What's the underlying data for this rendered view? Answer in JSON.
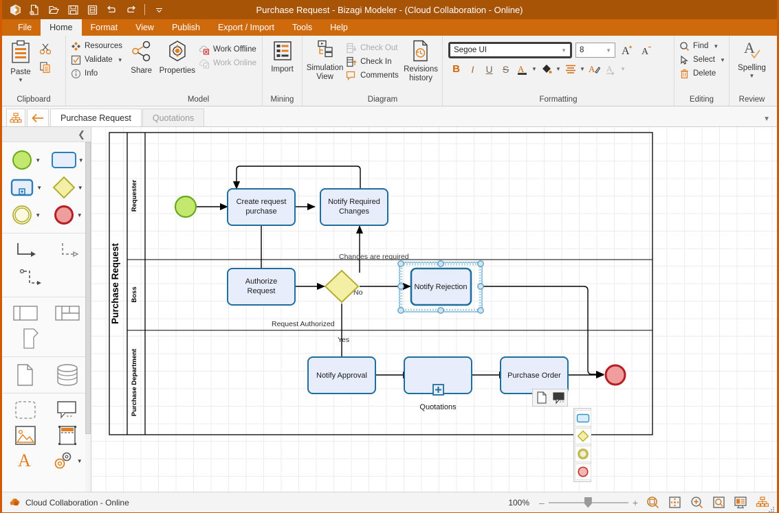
{
  "window": {
    "title": "Purchase Request - Bizagi Modeler - (Cloud Collaboration - Online)",
    "accent": "#cf6a0c",
    "titlebar_bg": "#a85406"
  },
  "quick_access": [
    {
      "name": "app-logo",
      "icon": "bizagi-logo-icon"
    },
    {
      "name": "new",
      "icon": "new-document-icon"
    },
    {
      "name": "open",
      "icon": "open-folder-icon"
    },
    {
      "name": "save",
      "icon": "save-disk-icon"
    },
    {
      "name": "save-as",
      "icon": "save-as-icon"
    },
    {
      "name": "undo",
      "icon": "undo-arrow-icon"
    },
    {
      "name": "redo",
      "icon": "redo-arrow-icon"
    },
    {
      "name": "customize",
      "icon": "chevron-down-icon"
    }
  ],
  "ribbon": {
    "tabs": [
      {
        "label": "File",
        "active": false
      },
      {
        "label": "Home",
        "active": true
      },
      {
        "label": "Format",
        "active": false
      },
      {
        "label": "View",
        "active": false
      },
      {
        "label": "Publish",
        "active": false
      },
      {
        "label": "Export / Import",
        "active": false
      },
      {
        "label": "Tools",
        "active": false
      },
      {
        "label": "Help",
        "active": false
      }
    ],
    "groups": {
      "clipboard": {
        "label": "Clipboard",
        "paste": "Paste",
        "cut_icon": "scissors-icon",
        "copy_icon": "copy-icon"
      },
      "model": {
        "label": "Model",
        "resources": "Resources",
        "validate": "Validate",
        "info": "Info",
        "share": "Share",
        "properties": "Properties",
        "work_offline": "Work Offline",
        "work_online": "Work Online"
      },
      "mining": {
        "label": "Mining",
        "import": "Import"
      },
      "diagram": {
        "label": "Diagram",
        "simulation_view": "Simulation\nView",
        "simulation_view_l1": "Simulation",
        "simulation_view_l2": "View",
        "check_out": "Check Out",
        "check_in": "Check In",
        "comments": "Comments",
        "revisions_l1": "Revisions",
        "revisions_l2": "history"
      },
      "formatting": {
        "label": "Formatting",
        "font_family": "Segoe UI",
        "font_size": "8",
        "grow_font": "A",
        "shrink_font": "A",
        "bold": "B",
        "italic": "I",
        "underline": "U",
        "strikethrough": "S",
        "font_color_icon": "font-color-icon",
        "fill_color_icon": "fill-color-icon",
        "align_icon": "align-icon",
        "format-painter_icon": "format-painter-icon",
        "clear_format_icon": "clear-formatting-icon"
      },
      "editing": {
        "label": "Editing",
        "find": "Find",
        "select": "Select",
        "delete": "Delete"
      },
      "review": {
        "label": "Review",
        "spelling": "Spelling"
      }
    }
  },
  "doc_tabs": {
    "diagram_list_icon": "diagram-tree-icon",
    "back_icon": "back-arrow-icon",
    "tabs": [
      {
        "label": "Purchase Request",
        "active": true
      },
      {
        "label": "Quotations",
        "active": false
      }
    ],
    "overflow_icon": "chevron-down-icon"
  },
  "palette": {
    "collapse_icon": "chevron-left-icon",
    "sections": [
      {
        "name": "events-activities",
        "rows": [
          [
            {
              "icon": "start-event-icon",
              "caret": true
            },
            {
              "icon": "task-icon",
              "caret": true
            }
          ],
          [
            {
              "icon": "subprocess-icon",
              "caret": true
            },
            {
              "icon": "gateway-icon",
              "caret": true
            }
          ],
          [
            {
              "icon": "intermediate-event-icon",
              "caret": true
            },
            {
              "icon": "end-event-icon",
              "caret": true
            }
          ]
        ]
      },
      {
        "name": "connectors",
        "rows": [
          [
            {
              "icon": "sequence-flow-icon",
              "caret": false
            },
            {
              "icon": "message-flow-icon",
              "caret": false
            }
          ],
          [
            {
              "icon": "association-icon",
              "caret": false
            }
          ]
        ]
      },
      {
        "name": "pools-lanes",
        "rows": [
          [
            {
              "icon": "pool-icon",
              "caret": false
            },
            {
              "icon": "lane-icon",
              "caret": false
            }
          ],
          [
            {
              "icon": "milestone-icon",
              "caret": false
            }
          ]
        ]
      },
      {
        "name": "artifacts-data",
        "rows": [
          [
            {
              "icon": "data-object-icon",
              "caret": false
            },
            {
              "icon": "data-store-icon",
              "caret": false
            }
          ]
        ]
      },
      {
        "name": "annotations",
        "rows": [
          [
            {
              "icon": "group-icon",
              "caret": false
            },
            {
              "icon": "annotation-icon",
              "caret": false
            }
          ],
          [
            {
              "icon": "image-icon",
              "caret": false
            },
            {
              "icon": "header-icon",
              "caret": false
            }
          ],
          [
            {
              "icon": "text-icon",
              "caret": false
            },
            {
              "icon": "custom-shapes-icon",
              "caret": true
            }
          ]
        ]
      }
    ]
  },
  "diagram": {
    "pool_label": "Purchase Request",
    "lanes": [
      {
        "label": "Requester"
      },
      {
        "label": "Boss"
      },
      {
        "label": "Purchase Department"
      }
    ],
    "shapes": {
      "start_event": {
        "name": "start-event",
        "fill": "#c3e86e",
        "stroke": "#6aa81a"
      },
      "create_request": {
        "label_l1": "Create request",
        "label_l2": "purchase"
      },
      "notify_required_changes": {
        "label_l1": "Notify Required",
        "label_l2": "Changes"
      },
      "authorize_request": {
        "label_l1": "Authorize",
        "label_l2": "Request"
      },
      "gateway": {
        "name": "exclusive-gateway",
        "fill": "#f3f0a5",
        "stroke": "#b5ad33"
      },
      "notify_rejection": {
        "label": "Notify Rejection",
        "selected": true
      },
      "notify_approval": {
        "label": "Notify Approval"
      },
      "quotations_subprocess": {
        "label": "Quotations",
        "marker": "+"
      },
      "purchase_order": {
        "label": "Purchase Order"
      },
      "end_event": {
        "name": "end-event",
        "fill": "#ef9d9d",
        "stroke": "#b31f24"
      }
    },
    "flow_labels": {
      "changes_required": "Changes are required",
      "no": "No",
      "request_authorized": "Request Authorized",
      "yes": "Yes"
    },
    "task_fill": "#e8edfb",
    "task_stroke": "#1f6e9c",
    "selection_color": "#4a90c4"
  },
  "context_toolbar": {
    "top_buttons": [
      {
        "name": "attach-document-button",
        "icon": "document-icon"
      },
      {
        "name": "add-annotation-button",
        "icon": "annotation-icon"
      }
    ],
    "side_buttons": [
      {
        "name": "convert-to-task-button",
        "icon": "task-icon"
      },
      {
        "name": "convert-to-gateway-button",
        "icon": "gateway-icon"
      },
      {
        "name": "convert-to-intermediate-event-button",
        "icon": "intermediate-event-icon"
      },
      {
        "name": "convert-to-end-event-button",
        "icon": "end-event-icon"
      }
    ]
  },
  "status_bar": {
    "connection": "Cloud Collaboration - Online",
    "connection_icon": "cloud-lock-icon",
    "zoom_percent": "100%",
    "zoom_minus": "–",
    "zoom_plus": "+",
    "buttons": [
      {
        "name": "zoom-selection-button",
        "icon": "zoom-selection-icon"
      },
      {
        "name": "fit-to-page-button",
        "icon": "fit-page-icon"
      },
      {
        "name": "zoom-in-button",
        "icon": "zoom-in-icon"
      },
      {
        "name": "zoom-window-button",
        "icon": "zoom-window-icon"
      },
      {
        "name": "presentation-view-button",
        "icon": "presentation-icon"
      },
      {
        "name": "diagram-view-button",
        "icon": "diagram-tree-icon"
      }
    ]
  }
}
